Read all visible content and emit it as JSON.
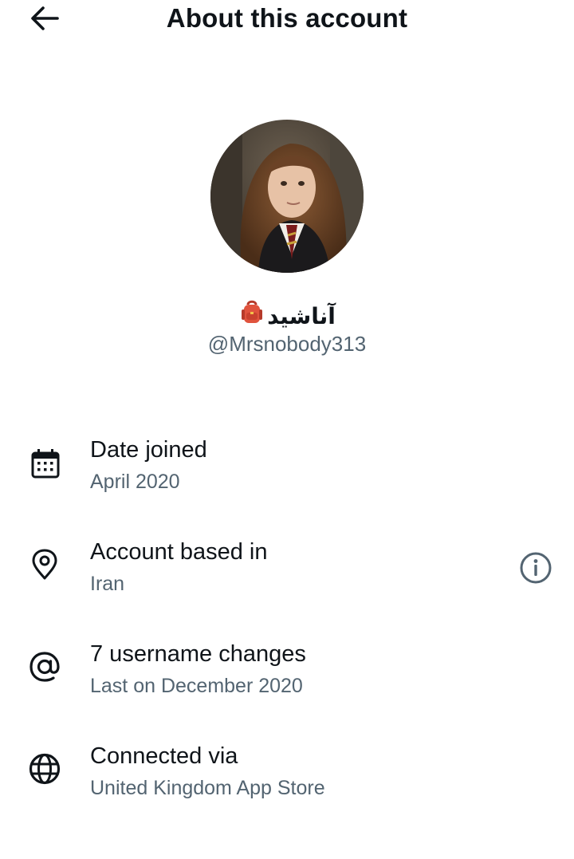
{
  "header": {
    "title": "About this account",
    "back_icon": "arrow-left-icon"
  },
  "profile": {
    "display_name": "آناشید",
    "name_emoji": "backpack-icon",
    "handle": "@Mrsnobody313",
    "avatar": "profile-photo"
  },
  "rows": [
    {
      "icon": "calendar-icon",
      "title": "Date joined",
      "subtitle": "April 2020"
    },
    {
      "icon": "location-pin-icon",
      "title": "Account based in",
      "subtitle": "Iran",
      "action_icon": "info-icon"
    },
    {
      "icon": "at-sign-icon",
      "title": "7 username changes",
      "subtitle": "Last on December 2020"
    },
    {
      "icon": "globe-icon",
      "title": "Connected via",
      "subtitle": "United Kingdom App Store"
    }
  ],
  "colors": {
    "text_primary": "#0f1419",
    "text_secondary": "#536471",
    "background": "#ffffff"
  }
}
